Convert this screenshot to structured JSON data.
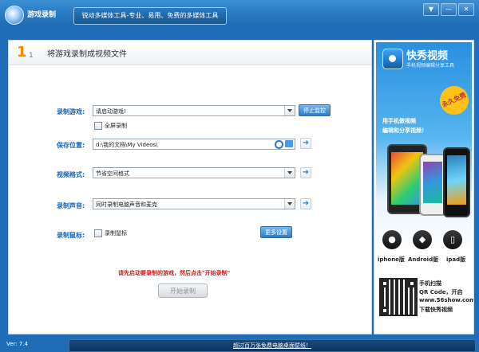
{
  "window": {
    "title": "游戏录制",
    "slogan": "锐动多媒体工具-专业、易用、免费的多媒体工具",
    "buttons": {
      "settings": "▼",
      "minimize": "—",
      "close": "✕"
    }
  },
  "step": {
    "number": "1",
    "total": "1",
    "title": "将游戏录制成视频文件"
  },
  "form": {
    "game": {
      "label": "录制游戏:",
      "value": "请启动游戏!",
      "action": "停止监控"
    },
    "fullscreen": {
      "label": "全屏录制",
      "checked": false
    },
    "save": {
      "label": "保存位置:",
      "value": "d:\\我的文档\\My Videos\\"
    },
    "format": {
      "label": "视频格式:",
      "value": "节省空间格式"
    },
    "audio": {
      "label": "录制声音:",
      "value": "同时录制电脑声音和麦克"
    },
    "mouse": {
      "label": "录制鼠标:",
      "checkbox_label": "录制鼠标",
      "checked": false,
      "more": "更多设置"
    },
    "hint": "请先启动要录制的游戏，然后点击\"开始录制\"",
    "start": "开始录制"
  },
  "ad": {
    "title": "快秀视频",
    "subtitle": "手机视频编辑分享工具",
    "badge": "永久免费",
    "line1": "用手机做视频",
    "line2": "编辑和分享视频！",
    "os": [
      {
        "label": "iphone版",
        "icon": "apple-icon"
      },
      {
        "label": "Android版",
        "icon": "android-icon"
      },
      {
        "label": "ipad版",
        "icon": "ipad-icon"
      }
    ],
    "qr_lines": [
      "手机扫描",
      "QR Code，开启",
      "www.56show.com",
      "下载快秀视频"
    ]
  },
  "status": {
    "version": "Ver: 7.4",
    "banner": "超过百万张免费电脑桌面壁纸！"
  }
}
